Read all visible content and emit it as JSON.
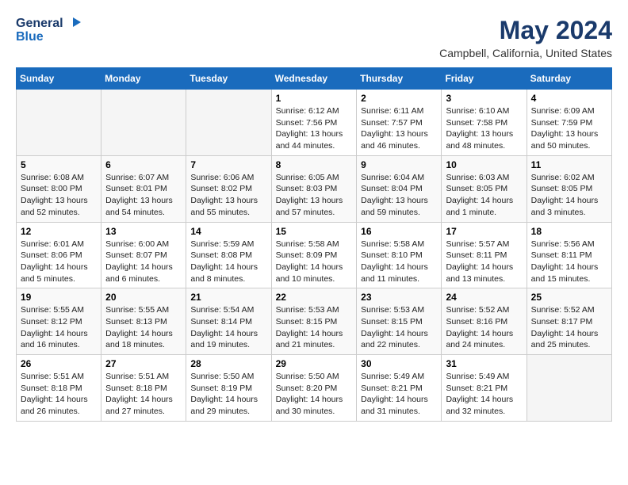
{
  "logo": {
    "text1": "General",
    "text2": "Blue"
  },
  "title": "May 2024",
  "subtitle": "Campbell, California, United States",
  "weekdays": [
    "Sunday",
    "Monday",
    "Tuesday",
    "Wednesday",
    "Thursday",
    "Friday",
    "Saturday"
  ],
  "weeks": [
    [
      {
        "day": "",
        "info": ""
      },
      {
        "day": "",
        "info": ""
      },
      {
        "day": "",
        "info": ""
      },
      {
        "day": "1",
        "info": "Sunrise: 6:12 AM\nSunset: 7:56 PM\nDaylight: 13 hours\nand 44 minutes."
      },
      {
        "day": "2",
        "info": "Sunrise: 6:11 AM\nSunset: 7:57 PM\nDaylight: 13 hours\nand 46 minutes."
      },
      {
        "day": "3",
        "info": "Sunrise: 6:10 AM\nSunset: 7:58 PM\nDaylight: 13 hours\nand 48 minutes."
      },
      {
        "day": "4",
        "info": "Sunrise: 6:09 AM\nSunset: 7:59 PM\nDaylight: 13 hours\nand 50 minutes."
      }
    ],
    [
      {
        "day": "5",
        "info": "Sunrise: 6:08 AM\nSunset: 8:00 PM\nDaylight: 13 hours\nand 52 minutes."
      },
      {
        "day": "6",
        "info": "Sunrise: 6:07 AM\nSunset: 8:01 PM\nDaylight: 13 hours\nand 54 minutes."
      },
      {
        "day": "7",
        "info": "Sunrise: 6:06 AM\nSunset: 8:02 PM\nDaylight: 13 hours\nand 55 minutes."
      },
      {
        "day": "8",
        "info": "Sunrise: 6:05 AM\nSunset: 8:03 PM\nDaylight: 13 hours\nand 57 minutes."
      },
      {
        "day": "9",
        "info": "Sunrise: 6:04 AM\nSunset: 8:04 PM\nDaylight: 13 hours\nand 59 minutes."
      },
      {
        "day": "10",
        "info": "Sunrise: 6:03 AM\nSunset: 8:05 PM\nDaylight: 14 hours\nand 1 minute."
      },
      {
        "day": "11",
        "info": "Sunrise: 6:02 AM\nSunset: 8:05 PM\nDaylight: 14 hours\nand 3 minutes."
      }
    ],
    [
      {
        "day": "12",
        "info": "Sunrise: 6:01 AM\nSunset: 8:06 PM\nDaylight: 14 hours\nand 5 minutes."
      },
      {
        "day": "13",
        "info": "Sunrise: 6:00 AM\nSunset: 8:07 PM\nDaylight: 14 hours\nand 6 minutes."
      },
      {
        "day": "14",
        "info": "Sunrise: 5:59 AM\nSunset: 8:08 PM\nDaylight: 14 hours\nand 8 minutes."
      },
      {
        "day": "15",
        "info": "Sunrise: 5:58 AM\nSunset: 8:09 PM\nDaylight: 14 hours\nand 10 minutes."
      },
      {
        "day": "16",
        "info": "Sunrise: 5:58 AM\nSunset: 8:10 PM\nDaylight: 14 hours\nand 11 minutes."
      },
      {
        "day": "17",
        "info": "Sunrise: 5:57 AM\nSunset: 8:11 PM\nDaylight: 14 hours\nand 13 minutes."
      },
      {
        "day": "18",
        "info": "Sunrise: 5:56 AM\nSunset: 8:11 PM\nDaylight: 14 hours\nand 15 minutes."
      }
    ],
    [
      {
        "day": "19",
        "info": "Sunrise: 5:55 AM\nSunset: 8:12 PM\nDaylight: 14 hours\nand 16 minutes."
      },
      {
        "day": "20",
        "info": "Sunrise: 5:55 AM\nSunset: 8:13 PM\nDaylight: 14 hours\nand 18 minutes."
      },
      {
        "day": "21",
        "info": "Sunrise: 5:54 AM\nSunset: 8:14 PM\nDaylight: 14 hours\nand 19 minutes."
      },
      {
        "day": "22",
        "info": "Sunrise: 5:53 AM\nSunset: 8:15 PM\nDaylight: 14 hours\nand 21 minutes."
      },
      {
        "day": "23",
        "info": "Sunrise: 5:53 AM\nSunset: 8:15 PM\nDaylight: 14 hours\nand 22 minutes."
      },
      {
        "day": "24",
        "info": "Sunrise: 5:52 AM\nSunset: 8:16 PM\nDaylight: 14 hours\nand 24 minutes."
      },
      {
        "day": "25",
        "info": "Sunrise: 5:52 AM\nSunset: 8:17 PM\nDaylight: 14 hours\nand 25 minutes."
      }
    ],
    [
      {
        "day": "26",
        "info": "Sunrise: 5:51 AM\nSunset: 8:18 PM\nDaylight: 14 hours\nand 26 minutes."
      },
      {
        "day": "27",
        "info": "Sunrise: 5:51 AM\nSunset: 8:18 PM\nDaylight: 14 hours\nand 27 minutes."
      },
      {
        "day": "28",
        "info": "Sunrise: 5:50 AM\nSunset: 8:19 PM\nDaylight: 14 hours\nand 29 minutes."
      },
      {
        "day": "29",
        "info": "Sunrise: 5:50 AM\nSunset: 8:20 PM\nDaylight: 14 hours\nand 30 minutes."
      },
      {
        "day": "30",
        "info": "Sunrise: 5:49 AM\nSunset: 8:21 PM\nDaylight: 14 hours\nand 31 minutes."
      },
      {
        "day": "31",
        "info": "Sunrise: 5:49 AM\nSunset: 8:21 PM\nDaylight: 14 hours\nand 32 minutes."
      },
      {
        "day": "",
        "info": ""
      }
    ]
  ]
}
